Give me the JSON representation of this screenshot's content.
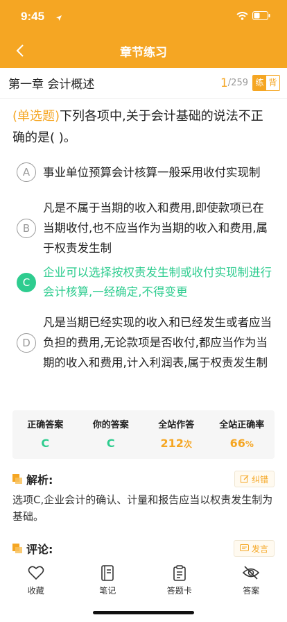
{
  "status_bar": {
    "time": "9:45"
  },
  "nav": {
    "title": "章节练习"
  },
  "chapter": {
    "title": "第一章 会计概述",
    "current": "1",
    "total": "/259",
    "mode_practice": "练",
    "mode_recite": "背"
  },
  "question": {
    "type": "(单选题)",
    "text": "下列各项中,关于会计基础的说法不正确的是(      )。"
  },
  "options": [
    {
      "letter": "A",
      "text": "事业单位预算会计核算一般采用收付实现制"
    },
    {
      "letter": "B",
      "text": "凡是不属于当期的收入和费用,即使款项已在当期收付,也不应当作为当期的收入和费用,属于权责发生制"
    },
    {
      "letter": "C",
      "text": "企业可以选择按权责发生制或收付实现制进行会计核算,一经确定,不得变更"
    },
    {
      "letter": "D",
      "text": "凡是当期已经实现的收入和已经发生或者应当负担的费用,无论款项是否收付,都应当作为当期的收入和费用,计入利润表,属于权责发生制"
    }
  ],
  "stats": {
    "correct_label": "正确答案",
    "correct_value": "C",
    "yours_label": "你的答案",
    "yours_value": "C",
    "attempts_label": "全站作答",
    "attempts_value": "212",
    "attempts_unit": "次",
    "rate_label": "全站正确率",
    "rate_value": "66",
    "rate_unit": "%"
  },
  "analysis": {
    "title": "解析:",
    "button": "纠错",
    "text": "选项C,企业会计的确认、计量和报告应当以权责发生制为基础。"
  },
  "comments": {
    "title": "评论:",
    "button": "发言"
  },
  "tabs": {
    "favorite": "收藏",
    "notes": "笔记",
    "answer_card": "答题卡",
    "answer": "答案"
  },
  "colors": {
    "accent": "#f5a623",
    "correct": "#2ecc8f"
  }
}
